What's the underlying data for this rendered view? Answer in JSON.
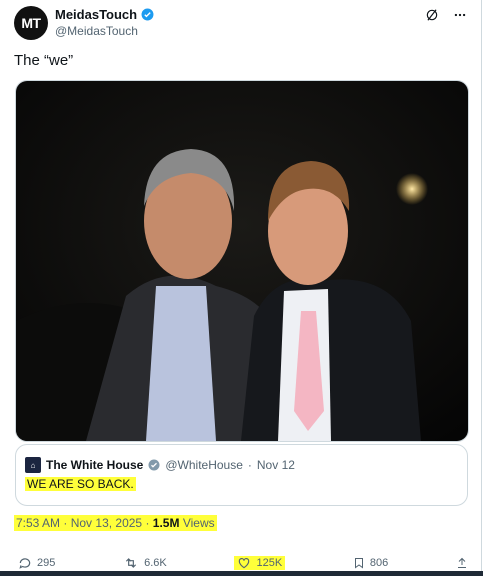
{
  "author": {
    "avatar_text": "MT",
    "display_name": "MeidasTouch",
    "handle": "@MeidasTouch"
  },
  "tweet": {
    "text": "The “we”"
  },
  "quote": {
    "name": "The White House",
    "handle": "@WhiteHouse",
    "date": "Nov 12",
    "text": "WE ARE SO BACK."
  },
  "meta": {
    "time": "7:53 AM",
    "date": "Nov 13, 2025",
    "views_count": "1.5M",
    "views_label": "Views"
  },
  "actions": {
    "replies": "295",
    "reposts": "6.6K",
    "likes": "125K",
    "bookmarks": "806"
  },
  "colors": {
    "highlight": "#ffff3a",
    "verified": "#1d9bf0",
    "muted": "#536471"
  },
  "icons": [
    "verified-badge-icon",
    "grok-icon",
    "more-icon",
    "reply-icon",
    "repost-icon",
    "like-icon",
    "bookmark-icon",
    "share-icon"
  ]
}
